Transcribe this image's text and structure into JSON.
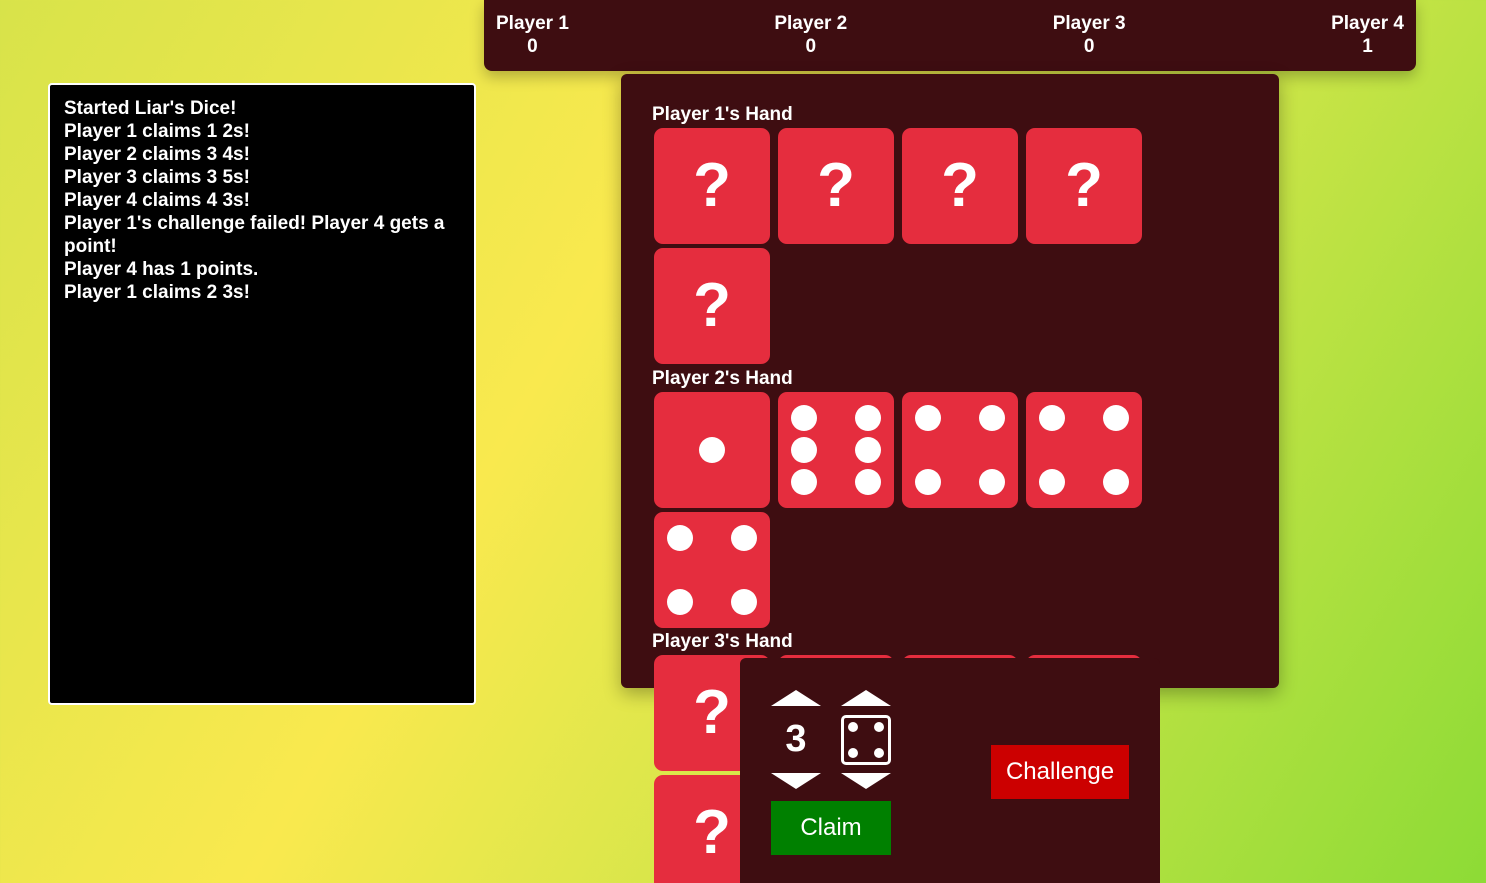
{
  "scores": [
    {
      "name": "Player 1",
      "points": "0"
    },
    {
      "name": "Player 2",
      "points": "0"
    },
    {
      "name": "Player 3",
      "points": "0"
    },
    {
      "name": "Player 4",
      "points": "1"
    }
  ],
  "log": [
    "Started Liar's Dice!",
    "Player 1 claims 1 2s!",
    "Player 2 claims 3 4s!",
    "Player 3 claims 3 5s!",
    "Player 4 claims 4 3s!",
    "Player 1's challenge failed! Player 4 gets a point!",
    "Player 4 has 1 points.",
    "Player 1 claims 2 3s!"
  ],
  "hands": [
    {
      "label": "Player 1's Hand",
      "dice": [
        "?",
        "?",
        "?",
        "?",
        "?"
      ]
    },
    {
      "label": "Player 2's Hand",
      "dice": [
        1,
        6,
        4,
        4,
        4
      ]
    },
    {
      "label": "Player 3's Hand",
      "dice": [
        "?",
        "?",
        "?",
        "?",
        "?"
      ]
    }
  ],
  "hidden_symbol": "?",
  "claim": {
    "quantity": "3",
    "face": 4
  },
  "buttons": {
    "claim": "Claim",
    "challenge": "Challenge"
  },
  "colors": {
    "die": "#e52d3e",
    "panel": "#3e0d11",
    "claim": "#008000",
    "challenge": "#cc0000"
  }
}
